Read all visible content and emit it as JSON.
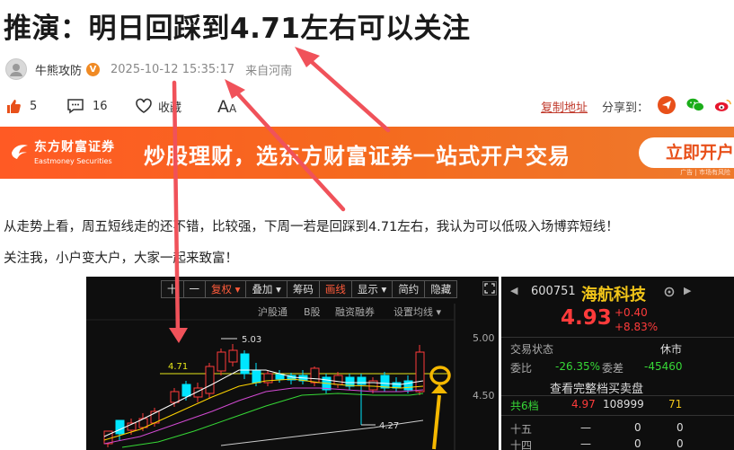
{
  "article": {
    "title": "推演：明日回踩到4.71左右可以关注",
    "author": "牛熊攻防",
    "badge": "V",
    "time": "2025-10-12 15:35:17",
    "source": "来自河南",
    "paragraphs": [
      "从走势上看，周五短线走的还不错，比较强，下周一若是回踩到4.71左右，我认为可以低吸入场博弈短线！",
      "关注我，小户变大户，大家一起来致富！"
    ]
  },
  "actions": {
    "likes": "5",
    "comments": "16",
    "favorite": "收藏",
    "font_big": "A",
    "font_small": "A",
    "copy_link": "复制地址",
    "share_to": "分享到："
  },
  "ad": {
    "logo_cn": "东方财富证券",
    "logo_en": "Eastmoney Securities",
    "slogan": "炒股理财，选东方财富证券一站式开户交易",
    "button": "立即开户",
    "tag": "广告 | 市场有风险"
  },
  "kchart": {
    "toolbar": [
      "十",
      "一",
      "复权 ▾",
      "叠加 ▾",
      "筹码",
      "画线",
      "显示 ▾",
      "简约",
      "隐藏"
    ],
    "toolbar_active": "复权 ▾",
    "submenu": [
      "沪股通",
      "B股",
      "融资融券",
      "设置均线 ▾"
    ],
    "price_labels": [
      "5.00",
      "4.50"
    ],
    "marker_high": "5.03",
    "marker_low": "4.27",
    "line_label": "4.71",
    "colors": {
      "up": "#ff3b3b",
      "down": "#00e6ff",
      "ma5": "#ffffff",
      "ma10": "#ffd400",
      "ma20": "#d24ad2",
      "ma30": "#36d836",
      "ref": "#e6e61a"
    }
  },
  "quote": {
    "code": "600751",
    "name": "海航科技",
    "price": "4.93",
    "change": "+0.40",
    "change_pct": "+8.83%",
    "state_label": "交易状态",
    "state_value": "休市",
    "weibi_label": "委比",
    "weibi_value": "-26.35%",
    "weicha_label": "委差",
    "weicha_value": "-45460",
    "full_book": "查看完整档买卖盘",
    "level6_label": "共6档",
    "level6_price": "4.97",
    "level6_vol": "108999",
    "level6_n": "71",
    "rows": [
      {
        "label": "十五",
        "price": "—",
        "vol": "0",
        "n": "0"
      },
      {
        "label": "十四",
        "price": "—",
        "vol": "0",
        "n": "0"
      }
    ]
  }
}
